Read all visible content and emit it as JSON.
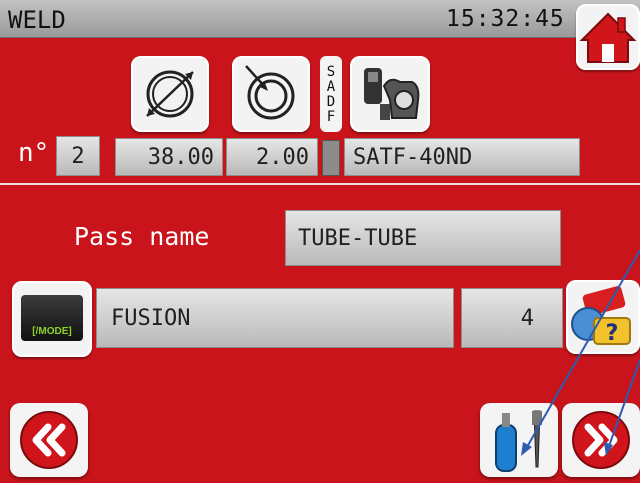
{
  "header": {
    "title": "WELD",
    "time": "15:32:45"
  },
  "tool": {
    "number_label": "n°",
    "number": "2",
    "diameter": "38.00",
    "thickness": "2.00",
    "sadf_label": "SADF",
    "head_model": "SATF-40ND"
  },
  "pass": {
    "name_label": "Pass name",
    "name": "TUBE-TUBE"
  },
  "mode": {
    "button_label": "[/MODE]",
    "value": "FUSION",
    "count": "4"
  },
  "icons": {
    "home": "home-icon",
    "outer_diameter": "outer-diameter-icon",
    "wall_thickness": "wall-thickness-icon",
    "weld_head": "weld-head-icon",
    "help": "help-icon",
    "gas_electrode": "gas-electrode-icon",
    "back": "double-chevron-left-icon",
    "next": "double-chevron-right-icon"
  },
  "colors": {
    "background": "#c8141a",
    "field": "#d6d6d6",
    "accent": "#cc1016"
  }
}
